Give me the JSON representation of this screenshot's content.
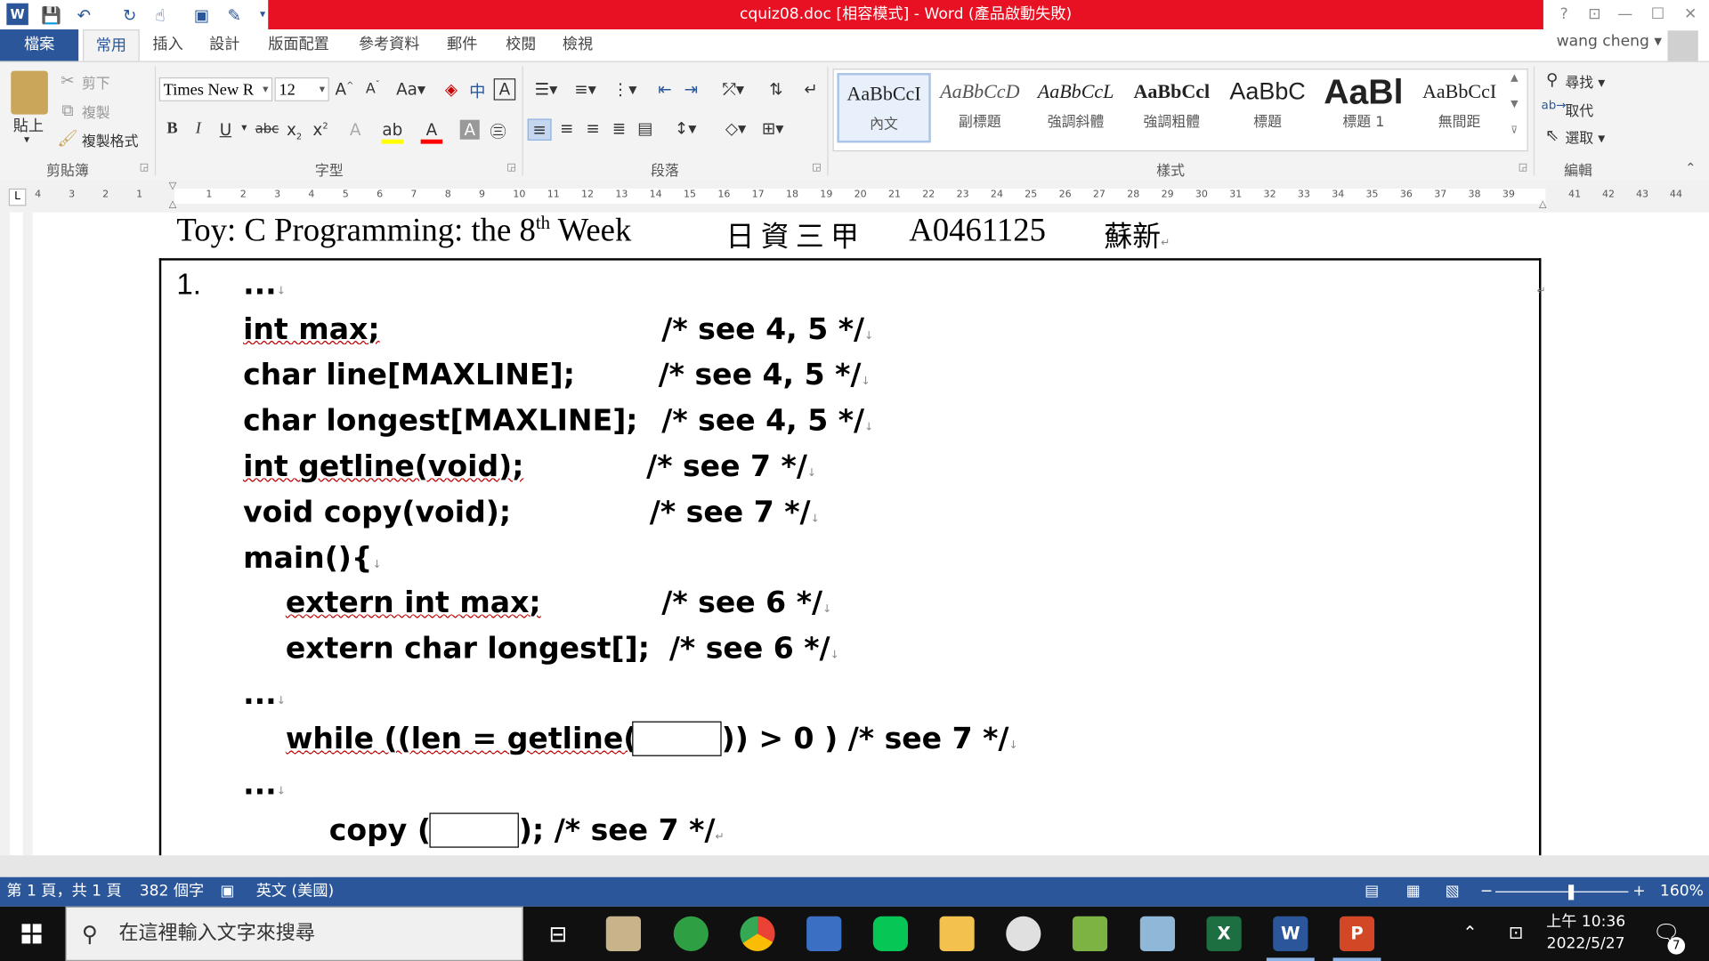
{
  "window": {
    "title": "cquiz08.doc [相容模式] -  Word (產品啟動失敗)",
    "user": "wang cheng"
  },
  "tabs": [
    "檔案",
    "常用",
    "插入",
    "設計",
    "版面配置",
    "參考資料",
    "郵件",
    "校閱",
    "檢視"
  ],
  "active_tab": "常用",
  "ribbon": {
    "clipboard": {
      "paste": "貼上",
      "cut": "剪下",
      "copy": "複製",
      "format_painter": "複製格式",
      "label": "剪貼簿"
    },
    "font": {
      "name": "Times New R",
      "size": "12",
      "label": "字型"
    },
    "paragraph": {
      "label": "段落"
    },
    "styles": {
      "label": "樣式",
      "items": [
        {
          "sample": "AaBbCcI",
          "name": "內文"
        },
        {
          "sample": "AaBbCcD",
          "name": "副標題"
        },
        {
          "sample": "AaBbCcL",
          "name": "強調斜體"
        },
        {
          "sample": "AaBbCcl",
          "name": "強調粗體"
        },
        {
          "sample": "AaBbC",
          "name": "標題"
        },
        {
          "sample": "AaBl",
          "name": "標題 1"
        },
        {
          "sample": "AaBbCcI",
          "name": "無間距"
        }
      ]
    },
    "editing": {
      "find": "尋找",
      "replace": "取代",
      "select": "選取",
      "label": "編輯"
    }
  },
  "ruler": {
    "left_ticks": [
      "4",
      "3",
      "2",
      "1"
    ],
    "right_ticks": [
      "1",
      "2",
      "3",
      "4",
      "5",
      "6",
      "7",
      "8",
      "9",
      "10",
      "11",
      "12",
      "13",
      "14",
      "15",
      "16",
      "17",
      "18",
      "19",
      "20",
      "21",
      "22",
      "23",
      "24",
      "25",
      "26",
      "27",
      "28",
      "29",
      "30",
      "31",
      "32",
      "33",
      "34",
      "35",
      "36",
      "37",
      "38",
      "39"
    ],
    "margin_ticks": [
      "41",
      "42",
      "43",
      "44"
    ]
  },
  "document": {
    "header_pre": "Toy: C Programming: the 8",
    "header_sup": "th",
    "header_post": " Week",
    "header_class": "日資三甲",
    "header_id": "A0461125",
    "header_name": "蘇新",
    "item_number": "1.",
    "lines": {
      "l1": "...",
      "l2_code": "int max;",
      "l2_cmt": "/* see 4, 5 */",
      "l3_code": "char line[MAXLINE];",
      "l3_cmt": "/* see 4, 5 */",
      "l4_code": "char longest[MAXLINE];",
      "l4_cmt": "/* see 4, 5 */",
      "l5_code": "int getline(void);",
      "l5_cmt": "/* see 7 */",
      "l6_code": "void copy(void);",
      "l6_cmt": "/* see 7 */",
      "l7": "main(){",
      "l8_code": "extern int max;",
      "l8_cmt": "/* see 6 */",
      "l9_code": "extern char longest[];",
      "l9_cmt": "/* see 6 */",
      "l10": "...",
      "l11_pre": "while ((len = getline(",
      "l11_post": ")) > 0 ) /* see 7 */",
      "l12": "...",
      "l13_pre": "copy (",
      "l13_post": "); /* see 7 */"
    }
  },
  "status": {
    "page": "第 1 頁，共 1 頁",
    "words": "382 個字",
    "language": "英文 (美國)",
    "zoom": "160%"
  },
  "taskbar": {
    "search_placeholder": "在這裡輸入文字來搜尋",
    "time": "上午 10:36",
    "date": "2022/5/27",
    "notifications": "7"
  }
}
